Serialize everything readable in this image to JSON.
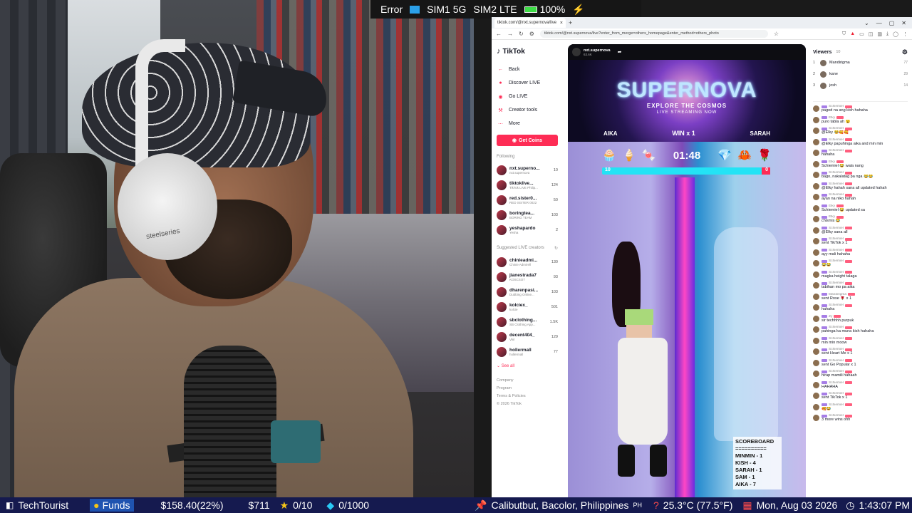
{
  "status_bar": {
    "error_label": "Error",
    "sim1": "SIM1 5G",
    "sim2": "SIM2 LTE",
    "battery": "100%",
    "battery_icon": "battery-icon",
    "charging_icon": "lightning-bolt-icon"
  },
  "webcam": {
    "headphone_brand": "steelseries"
  },
  "browser": {
    "tab_title": "tiktok.com/@nxt.supernova/live",
    "url": "tiktok.com/@nxt.supernova/live?enter_from_merge=others_homepage&enter_method=others_photo",
    "new_tab_symbol": "+"
  },
  "tiktok": {
    "logo": "TikTok",
    "nav": [
      {
        "label": "Back",
        "icon": "arrow-left-icon"
      },
      {
        "label": "Discover LIVE",
        "icon": "live-icon"
      },
      {
        "label": "Go LIVE",
        "icon": "camera-icon"
      },
      {
        "label": "Creator tools",
        "icon": "tools-icon"
      },
      {
        "label": "More",
        "icon": "more-icon"
      }
    ],
    "get_coins": "Get Coins",
    "following_title": "Following",
    "following": [
      {
        "name": "nxt.superno...",
        "sub": "nxt.supernova",
        "count": "10"
      },
      {
        "name": "tiktoklive...",
        "sub": "TikTok LIVE Philip...",
        "count": "124"
      },
      {
        "name": "red.sister0...",
        "sub": "RED SISTER 0022",
        "count": "50"
      },
      {
        "name": "boringtea...",
        "sub": "BORING TEAM",
        "count": "103"
      },
      {
        "name": "yeshapardo",
        "sub": "Yesha",
        "count": "2"
      }
    ],
    "suggested_title": "Suggested LIVE creators",
    "suggested": [
      {
        "name": "chinieadmi...",
        "sub": "Chinie Admirell",
        "count": "130"
      },
      {
        "name": "jianestrada7",
        "sub": "KOSCSO7",
        "count": "93"
      },
      {
        "name": "dharenpasi...",
        "sub": "Dubbing Online...",
        "count": "103"
      },
      {
        "name": "kolciex_",
        "sub": "kolcie",
        "count": "501"
      },
      {
        "name": "sbclothing...",
        "sub": "SB Clothing App...",
        "count": "1.5K"
      },
      {
        "name": "decent404_",
        "sub": "Vkir",
        "count": "129"
      },
      {
        "name": "hollermall",
        "sub": "hollermall",
        "count": "77"
      }
    ],
    "see_all": "See all",
    "footer": [
      "Company",
      "Program",
      "Terms & Policies",
      "© 2026 TikTok"
    ]
  },
  "stream": {
    "host": "nxt.supernova",
    "likes": "63.6K",
    "banner_title": "SUPERNOVA",
    "banner_sub1": "EXPLORE THE COSMOS",
    "banner_sub2": "LIVE STREAMING NOW",
    "left_player": "AIKA",
    "win_label": "WIN x 1",
    "right_player": "SARAH",
    "timer": "01:48",
    "left_score": "10",
    "right_score": "0",
    "gifts": [
      "🧁",
      "🍦",
      "🍬",
      "💎",
      "🦀",
      "🌹"
    ],
    "scoreboard": {
      "title": "SCOREBOARD",
      "sep": "==========",
      "rows": [
        "MINMIN - 1",
        "KISH - 4",
        "SARAH - 1",
        "SAM - 1",
        "AIKA - 7"
      ]
    }
  },
  "viewers": {
    "title": "Viewers",
    "count": "10",
    "list": [
      {
        "rank": "1",
        "name": "Mandirigma",
        "score": "77"
      },
      {
        "rank": "2",
        "name": "kane",
        "score": "29"
      },
      {
        "rank": "3",
        "name": "josh",
        "score": "14"
      }
    ]
  },
  "chat": [
    {
      "user": "Schiemiel",
      "text": "pagod na ang kish hahaha"
    },
    {
      "user": "Elky",
      "text": "puro tabla ah 😮"
    },
    {
      "user": "Schiemiel",
      "text": "@Elky 😂🥰🥰"
    },
    {
      "user": "Schiemiel",
      "text": "@Elky papuhinga aika and min min"
    },
    {
      "user": "Schiemiel",
      "text": "hahaha"
    },
    {
      "user": "Elky",
      "text": "Schiemiel 😂 wala nang"
    },
    {
      "user": "Schiemiel",
      "text": "bago, nakalatag pa nga 😂😂"
    },
    {
      "user": "Schiemiel",
      "text": "@Elky hahah sana all updated hahah"
    },
    {
      "user": "Schiemiel",
      "text": "ayan na niko hahah"
    },
    {
      "user": "Elky",
      "text": "Schiemiel 😂 updated sa"
    },
    {
      "user": "Elky",
      "text": "chismis 😂"
    },
    {
      "user": "Schiemiel",
      "text": "@Elky sana all"
    },
    {
      "user": "Schiemiel",
      "text": "sent TikTok x 1"
    },
    {
      "user": "Schiemiel",
      "text": "ayy mali hahaha"
    },
    {
      "user": "Schiemiel",
      "text": "😂😂"
    },
    {
      "user": "Schiemiel",
      "text": "magka height talaga"
    },
    {
      "user": "Schiemiel",
      "text": "tabihan mo pa aika"
    },
    {
      "user": "Mandirigma",
      "text": "sent Rose 🌹 x 1"
    },
    {
      "user": "Schiemiel",
      "text": "hahaha"
    },
    {
      "user": "Zy",
      "text": "sir techhhh purpuk"
    },
    {
      "user": "Schiemiel",
      "text": "pahinga ka muna kish hahaha"
    },
    {
      "user": "Schiemiel",
      "text": "min min moow"
    },
    {
      "user": "Schiemiel",
      "text": "sent Heart Me x 1"
    },
    {
      "user": "Schiemiel",
      "text": "sent Go Popular x 1"
    },
    {
      "user": "Schiemiel",
      "text": "hirap mamili hahaah"
    },
    {
      "user": "Schiemiel",
      "text": "HAHAHA"
    },
    {
      "user": "Schiemiel",
      "text": "sent TikTok x 1"
    },
    {
      "user": "Schiemiel",
      "text": "🥰😂"
    },
    {
      "user": "Schiemiel",
      "text": "3 more wins ohh"
    }
  ],
  "ticker": {
    "channel": "TechTourist",
    "funds_label": "Funds",
    "funds_value": "$158.40(22%)",
    "goal": "$711",
    "stars": "0/10",
    "gems": "0/1000",
    "location": "Calibutbut, Bacolor, Philippines",
    "country_code": "PH",
    "weather": "25.3°C (77.5°F)",
    "date": "Mon, Aug 03 2026",
    "time": "1:43:07 PM"
  },
  "colors": {
    "tiktok_red": "#fe2c55",
    "ticker_bg": "#151a4f",
    "funds_bg": "#1f53b0"
  }
}
